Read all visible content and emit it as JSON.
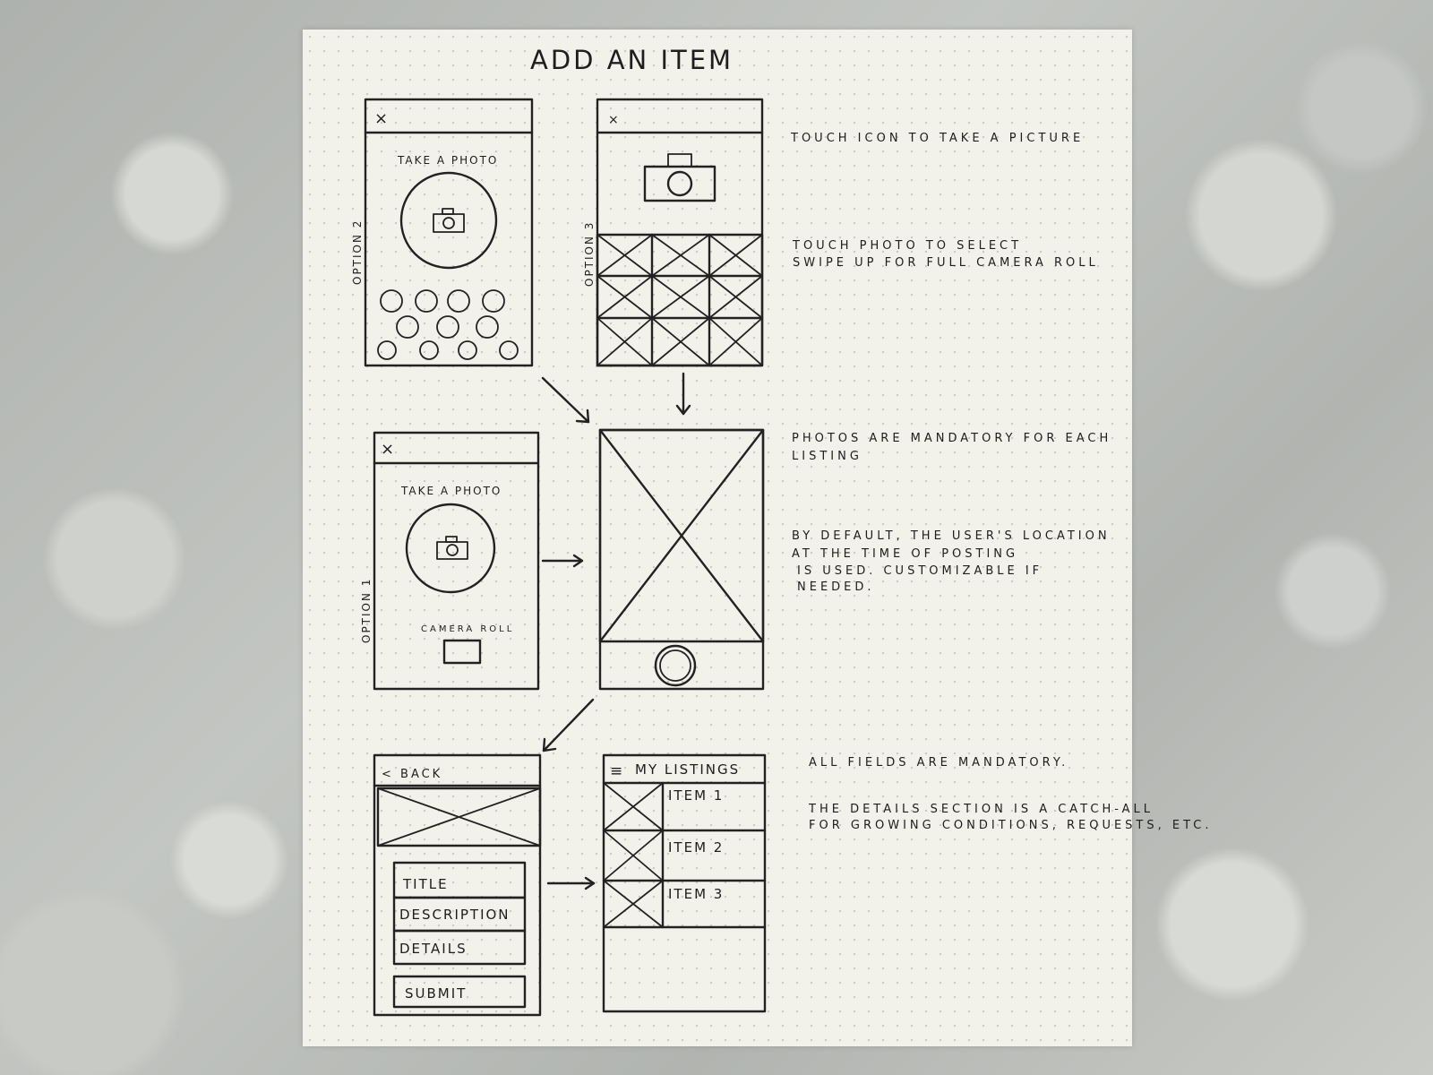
{
  "title": "ADD AN ITEM",
  "screens": {
    "option2": {
      "side_label": "OPTION 2",
      "close": "×",
      "heading": "TAKE A PHOTO"
    },
    "option3": {
      "side_label": "OPTION 3",
      "close": "×"
    },
    "option1": {
      "side_label": "OPTION 1",
      "close": "×",
      "heading": "TAKE A PHOTO",
      "camera_roll": "CAMERA ROLL"
    },
    "form": {
      "back": "< BACK",
      "fields": [
        "TITLE",
        "DESCRIPTION",
        "DETAILS"
      ],
      "submit": "SUBMIT"
    },
    "listings": {
      "menu": "≡",
      "heading": "MY LISTINGS",
      "items": [
        "ITEM 1",
        "ITEM 2",
        "ITEM 3"
      ]
    }
  },
  "notes": {
    "n1": "TOUCH ICON TO TAKE A PICTURE",
    "n2a": "TOUCH PHOTO TO SELECT",
    "n2b": "SWIPE UP FOR FULL CAMERA ROLL",
    "n3a": "PHOTOS ARE MANDATORY FOR EACH",
    "n3b": "LISTING",
    "n4a": "BY DEFAULT, THE USER'S LOCATION",
    "n4b": "AT THE TIME OF POSTING",
    "n4c": "IS USED. CUSTOMIZABLE IF",
    "n4d": "NEEDED.",
    "n5": "ALL FIELDS ARE MANDATORY.",
    "n6a": "THE DETAILS SECTION IS A CATCH-ALL",
    "n6b": "FOR GROWING CONDITIONS, REQUESTS, ETC."
  }
}
